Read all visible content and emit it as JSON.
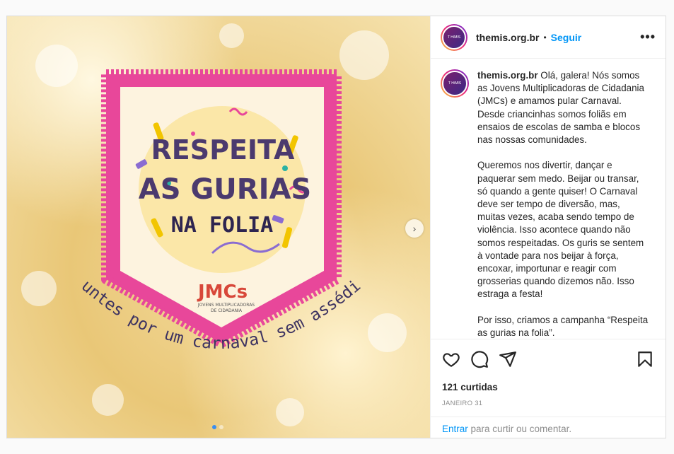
{
  "post": {
    "username": "themis.org.br",
    "dot": "•",
    "follow_label": "Seguir",
    "more_label": "•••",
    "avatar_text": "T H/MIS",
    "caption": "Olá, galera! Nós somos as Jovens Multiplicadoras de Cidadania (JMCs) e amamos pular Carnaval. Desde criancinhas somos foliãs em ensaios de escolas de samba e blocos nas nossas comunidades.\n\nQueremos nos divertir, dançar e paquerar sem medo. Beijar ou transar, só quando a gente quiser! O Carnaval deve ser tempo de diversão, mas, muitas vezes, acaba sendo tempo de violência. Isso acontece quando não somos respeitadas. Os guris se sentem à vontade para nos beijar à força, encoxar, importunar e reagir com grosserias quando dizemos não. Isso estraga a festa!\n\nPor isso, criamos a campanha “Respeita as gurias na folia”.",
    "likes": "121 curtidas",
    "date": "JANEIRO 31",
    "login_link": "Entrar",
    "login_text": " para curtir ou comentar."
  },
  "image": {
    "line1": "RESPEITA",
    "line2": "AS GURIAS",
    "line3": "NA FOLIA",
    "logo": "JMCs",
    "logo_sub1": "JOVENS MULTIPLICADORAS",
    "logo_sub2": "DE CIDADANIA",
    "arc_text": "Juntes por um carnaval sem assédio"
  },
  "colors": {
    "accent": "#0095f6",
    "pink": "#e8479a",
    "cream": "#fdf3df",
    "purple_text": "#4b3a6e"
  },
  "icons": [
    "heart-icon",
    "comment-icon",
    "share-icon",
    "bookmark-icon",
    "chevron-right-icon",
    "more-icon"
  ]
}
